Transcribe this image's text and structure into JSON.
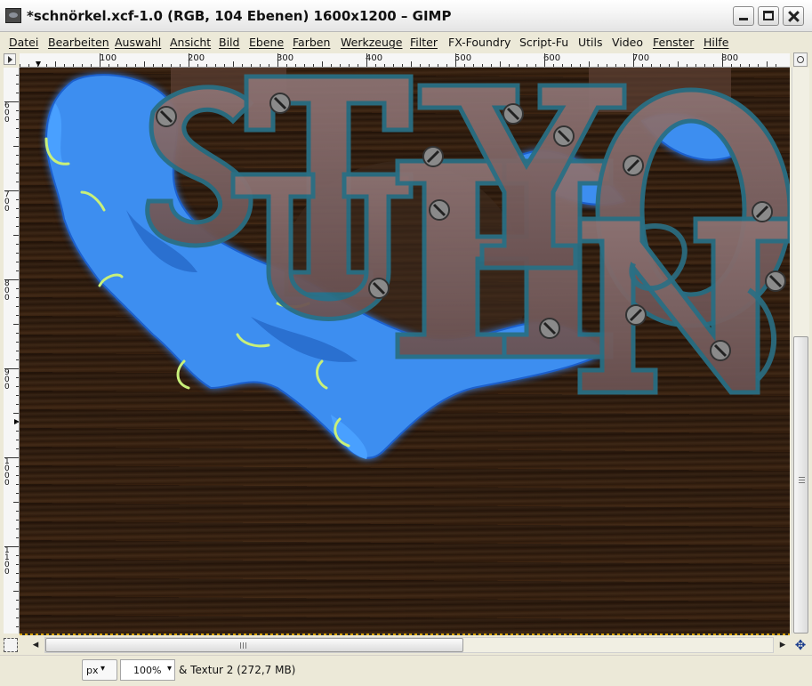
{
  "window": {
    "title": "*schnörkel.xcf-1.0 (RGB, 104 Ebenen) 1600x1200 – GIMP"
  },
  "menu": {
    "items": [
      {
        "label": "Datei"
      },
      {
        "label": "Bearbeiten"
      },
      {
        "label": "Auswahl"
      },
      {
        "label": "Ansicht"
      },
      {
        "label": "Bild"
      },
      {
        "label": "Ebene"
      },
      {
        "label": "Farben"
      },
      {
        "label": "Werkzeuge"
      },
      {
        "label": "Filter"
      },
      {
        "label": "FX-Foundry"
      },
      {
        "label": "Script-Fu"
      },
      {
        "label": "Utils"
      },
      {
        "label": "Video"
      },
      {
        "label": "Fenster"
      },
      {
        "label": "Hilfe"
      }
    ]
  },
  "rulers": {
    "horizontal_labels": [
      "100",
      "200",
      "300",
      "400",
      "500",
      "600",
      "700",
      "800"
    ],
    "vertical_labels": [
      "600",
      "700",
      "800",
      "900",
      "1000",
      "1100"
    ]
  },
  "status": {
    "unit": "px",
    "zoom": "100%",
    "message": "& Textur 2 (272,7 MB)"
  },
  "colors": {
    "wood": "#2f1c0e",
    "splash_blue": "#3d8ef0",
    "splash_highlight": "#c8f07a",
    "letter_fill": "#7d6464",
    "letter_outline": "#2a6f84",
    "chrome": "#ece9d8"
  },
  "icons": {
    "app": "gimp-icon",
    "minimize": "minimize-icon",
    "maximize": "maximize-icon",
    "close": "close-icon",
    "navigate": "navigate-icon"
  }
}
